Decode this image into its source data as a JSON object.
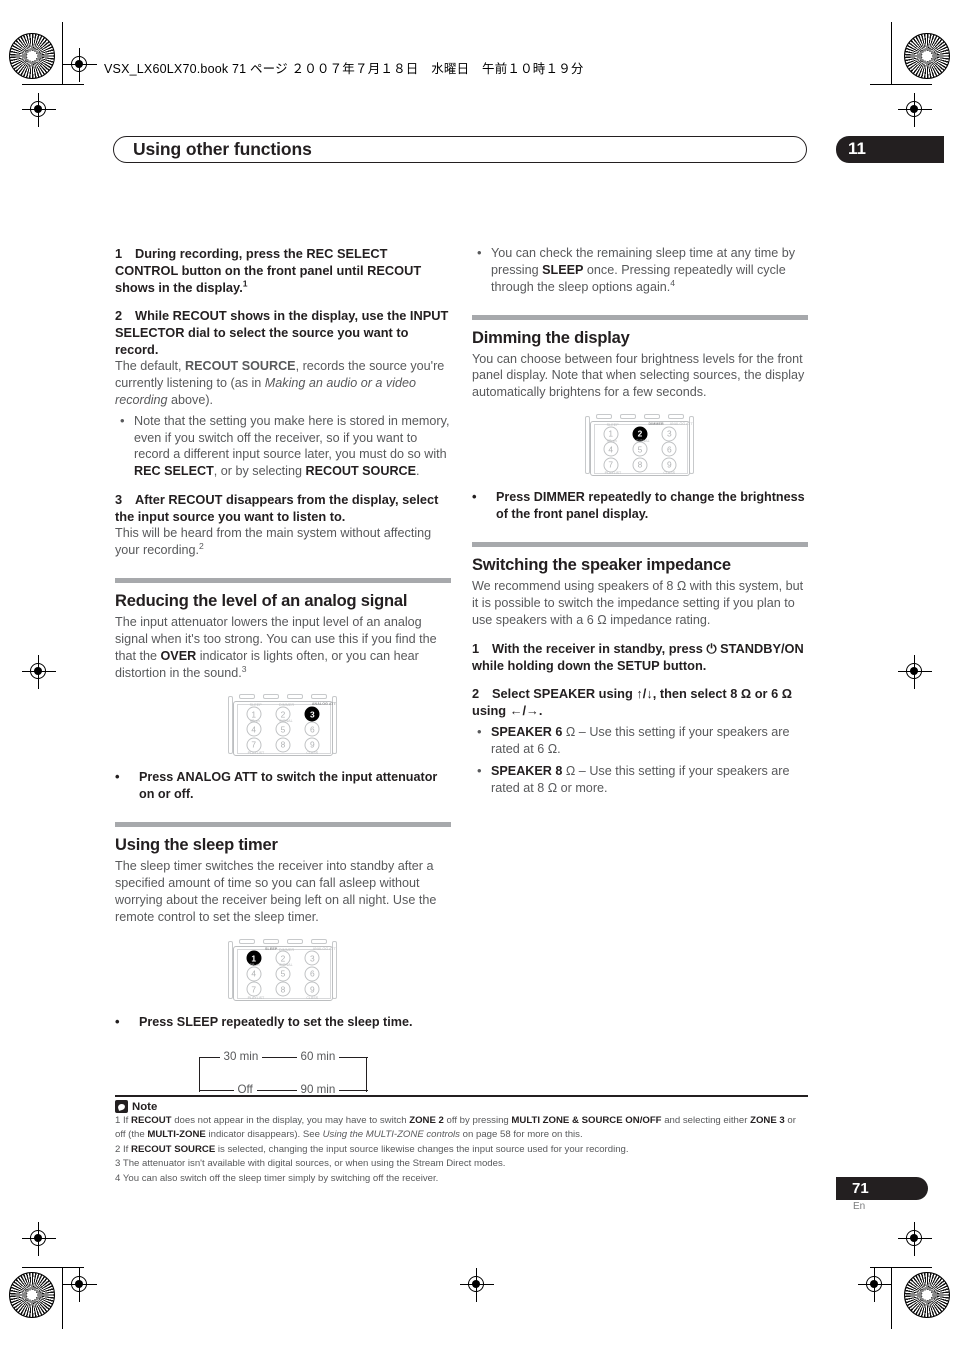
{
  "header": {
    "book_line": "VSX_LX60LX70.book 71 ページ ２００７年７月１８日　水曜日　午前１０時１９分"
  },
  "chapter": {
    "title": "Using other functions",
    "number": "11"
  },
  "left_column": {
    "step1": {
      "num": "1",
      "text": "During recording, press the REC SELECT CONTROL button on the front panel until RECOUT shows in the display.",
      "footnote_ref": "1"
    },
    "step2": {
      "num": "2",
      "text": "While RECOUT shows in the display, use the INPUT SELECTOR dial to select the source you want to record.",
      "body_pre": "The default, ",
      "body_bold": "RECOUT SOURCE",
      "body_mid": ", records the source you're currently listening to (as in ",
      "body_italic": "Making an audio or a video recording",
      "body_post": " above)."
    },
    "step2_bullet": {
      "pre": "Note that the setting you make here is stored in memory, even if you switch off the receiver, so if you want to record a different input source later, you must do so with ",
      "bold1": "REC SELECT",
      "mid": ", or by selecting ",
      "bold2": "RECOUT SOURCE",
      "post": "."
    },
    "step3": {
      "num": "3",
      "text": "After RECOUT disappears from the display, select the input source you want to listen to.",
      "body": "This will be heard from the main system without affecting your recording.",
      "footnote_ref": "2"
    },
    "section_analog": {
      "heading": "Reducing the level of an analog signal",
      "body_pre": "The input attenuator lowers the input level of an analog signal when it's too strong. You can use this if you find the that the ",
      "body_bold": "OVER",
      "body_post": " indicator is lights often, or you can hear distortion in the sound.",
      "footnote_ref": "3",
      "remote": {
        "highlight_key": "3",
        "highlight_label": "ANALOG ATT",
        "keys": [
          "1",
          "2",
          "3",
          "4",
          "5",
          "6",
          "7",
          "8",
          "9"
        ],
        "key_labels": {
          "1": "SLEEP",
          "2": "DIMMER",
          "3": "ANALOG ATT",
          "4": "SB ch",
          "5": "SIGNAL",
          "7": "PLAYLIST",
          "9": "CLASS"
        }
      },
      "bullet": "Press ANALOG ATT to switch the input attenuator on or off."
    },
    "section_sleep": {
      "heading": "Using the sleep timer",
      "body": "The sleep timer switches the receiver into standby after a specified amount of time so you can fall asleep without worrying about the receiver being left on all night. Use the remote control to set the sleep timer.",
      "remote": {
        "highlight_key": "1",
        "highlight_label": "SLEEP",
        "keys": [
          "1",
          "2",
          "3",
          "4",
          "5",
          "6",
          "7",
          "8",
          "9"
        ],
        "key_labels": {
          "1": "SLEEP",
          "2": "DIMMER",
          "3": "ANALOG ATT",
          "4": "SB ch",
          "5": "SIGNAL",
          "7": "PLAYLIST",
          "9": "CLASS"
        }
      },
      "bullet": "Press SLEEP repeatedly to set the sleep time.",
      "cycle": {
        "top_left": "30 min",
        "top_right": "60 min",
        "bottom_left": "Off",
        "bottom_right": "90 min"
      }
    }
  },
  "right_column": {
    "sleep_bullet": {
      "pre": "You can check the remaining sleep time at any time by pressing ",
      "bold": "SLEEP",
      "post": " once. Pressing repeatedly will cycle through the sleep options again.",
      "footnote_ref": "4"
    },
    "section_dimming": {
      "heading": "Dimming the display",
      "body": "You can choose between four brightness levels for the front panel display. Note that when selecting sources, the display automatically brightens for a few seconds.",
      "remote": {
        "highlight_key": "2",
        "highlight_label": "DIMMER",
        "keys": [
          "1",
          "2",
          "3",
          "4",
          "5",
          "6",
          "7",
          "8",
          "9"
        ],
        "key_labels": {
          "1": "SLEEP",
          "2": "DIMMER",
          "3": "ANALOG ATT",
          "4": "SB ch",
          "5": "SIGNAL",
          "7": "PLAYLIST",
          "9": "CLASS"
        }
      },
      "bullet": "Press DIMMER repeatedly to change the brightness of the front panel display."
    },
    "section_impedance": {
      "heading": "Switching the speaker impedance",
      "body": "We recommend using speakers of 8 Ω with this system, but it is possible to switch the impedance setting if you plan to use speakers with a 6 Ω impedance rating.",
      "step1": {
        "num": "1",
        "text_pre": "With the receiver in standby, press ",
        "power_icon": "⏻",
        "text_post": " STANDBY/ON while holding down the SETUP button."
      },
      "step2": {
        "num": "2",
        "text_pre": "Select SPEAKER using ",
        "arrow_up": "↑",
        "arrow_down": "↓",
        "text_mid": ", then select 8 Ω or 6 Ω using ",
        "arrow_left": "←",
        "arrow_right": "→",
        "text_post": "."
      },
      "bullets": [
        {
          "bold": "SPEAKER 6",
          "ohm": " Ω",
          "rest": " – Use this setting if your speakers are rated at 6 Ω."
        },
        {
          "bold": "SPEAKER 8",
          "ohm": " Ω",
          "rest": " – Use this setting if your speakers are rated at 8 Ω or more."
        }
      ]
    }
  },
  "notes": {
    "title": "Note",
    "items": [
      {
        "num": "1",
        "p1": "If ",
        "b1": "RECOUT",
        "p2": " does not appear in the display, you may have to switch ",
        "b2": "ZONE 2",
        "p3": " off by pressing ",
        "b3": "MULTI ZONE & SOURCE ON/OFF",
        "p4": " and selecting either ",
        "b4": "ZONE 3",
        "p5": " or off (the ",
        "b5": "MULTI-ZONE",
        "p6": " indicator disappears). See ",
        "i1": "Using the MULTI-ZONE controls",
        "p7": " on page 58 for more on this."
      },
      {
        "num": "2",
        "p1": "If ",
        "b1": "RECOUT SOURCE",
        "p2": " is selected, changing the input source likewise changes the input source used for your recording."
      },
      {
        "num": "3",
        "p1": "The attenuator isn't available with digital sources, or when using the Stream Direct modes."
      },
      {
        "num": "4",
        "p1": "You can also switch off the sleep timer simply by switching off the receiver."
      }
    ]
  },
  "footer": {
    "page_number": "71",
    "language": "En"
  }
}
